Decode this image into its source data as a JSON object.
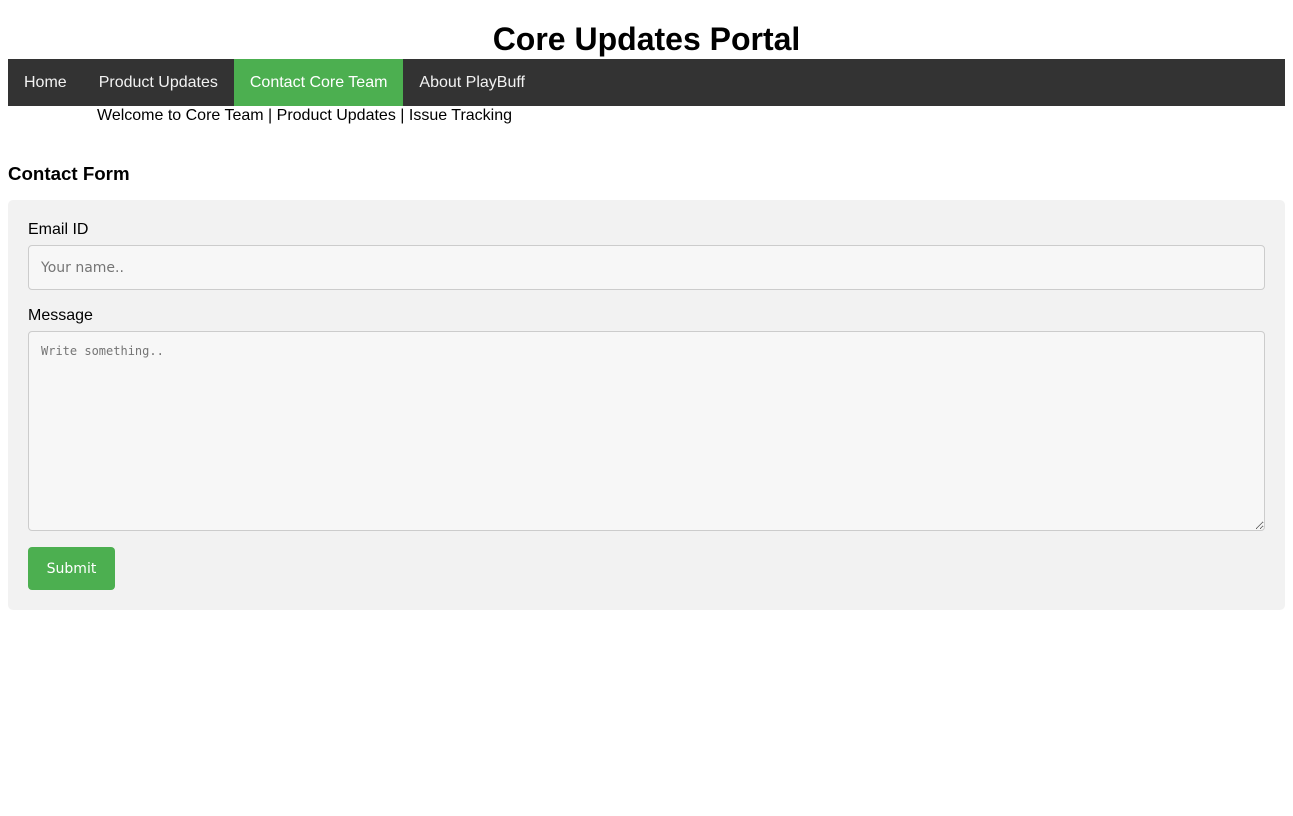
{
  "header": {
    "title": "Core Updates Portal"
  },
  "nav": {
    "items": [
      {
        "label": "Home",
        "active": false
      },
      {
        "label": "Product Updates",
        "active": false
      },
      {
        "label": "Contact Core Team",
        "active": true
      },
      {
        "label": "About PlayBuff",
        "active": false
      }
    ]
  },
  "subnav": {
    "links": [
      "Welcome to Core Team",
      "Product Updates",
      "Issue Tracking"
    ],
    "separator": " | "
  },
  "form": {
    "heading": "Contact Form",
    "email_label": "Email ID",
    "email_placeholder": "Your name..",
    "email_value": "",
    "message_label": "Message",
    "message_placeholder": "Write something..",
    "message_value": "",
    "submit_label": "Submit"
  },
  "colors": {
    "nav_bg": "#333333",
    "accent": "#4CAF50",
    "form_bg": "#f2f2f2"
  }
}
